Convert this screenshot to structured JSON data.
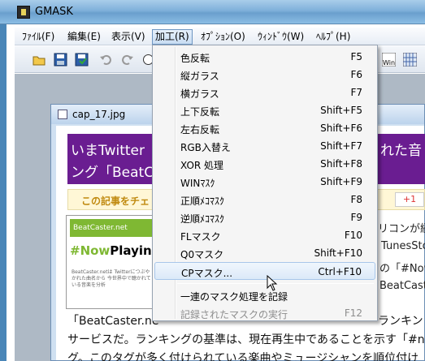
{
  "app": {
    "title": "GMASK"
  },
  "menubar": {
    "items": [
      {
        "label": "ﾌｧｲﾙ(F)"
      },
      {
        "label": "編集(E)"
      },
      {
        "label": "表示(V)"
      },
      {
        "label": "加工(R)"
      },
      {
        "label": "ｵﾌﾟｼｮﾝ(O)"
      },
      {
        "label": "ｳｨﾝﾄﾞｳ(W)"
      },
      {
        "label": "ﾍﾙﾌﾟ(H)"
      }
    ]
  },
  "toolbar": {
    "buttons": [
      "open-icon",
      "save-icon",
      "save-as-icon",
      "undo-icon",
      "redo-icon",
      "stop-icon"
    ],
    "right_label": "Win"
  },
  "child_window": {
    "title": "cap_17.jpg"
  },
  "page_content": {
    "headline_line1": "いまTwitter",
    "headline_line1_tail": "れた音",
    "headline_line2": "ング「BeatCa",
    "notice": "この記事をチェ",
    "gplus": "+1",
    "thumb_site": "BeatCaster.net",
    "thumb_tag_hash": "#Now",
    "thumb_tag_rest": "Playing!",
    "thumb_small": "BeatCaster.netは Twitterにつぶやかれた曲名から 今世界中で聴かれている音楽を分析",
    "right_lines": [
      "リコンが綴",
      "TunesSto",
      "の「#Now",
      "BeatCaste"
    ],
    "body_lines": [
      "「BeatCaster.ne",
      "サービスだ。ランキングの基準は、現在再生中であることを示す「#n",
      "グ。このタグが多く付けられている楽曲やミュージシャンを順位付け"
    ],
    "body_right": "ランキン"
  },
  "dropdown": {
    "items": [
      {
        "label": "色反転",
        "shortcut": "F5"
      },
      {
        "label": "縦ガラス",
        "shortcut": "F6"
      },
      {
        "label": "横ガラス",
        "shortcut": "F7"
      },
      {
        "label": "上下反転",
        "shortcut": "Shift+F5"
      },
      {
        "label": "左右反転",
        "shortcut": "Shift+F6"
      },
      {
        "label": "RGB入替え",
        "shortcut": "Shift+F7"
      },
      {
        "label": "XOR 処理",
        "shortcut": "Shift+F8"
      },
      {
        "label": "WINﾏｽｸ",
        "shortcut": "Shift+F9"
      },
      {
        "label": "正順ﾒｺﾏｽｸ",
        "shortcut": "F8"
      },
      {
        "label": "逆順ﾒｺﾏｽｸ",
        "shortcut": "F9"
      },
      {
        "label": "FLマスク",
        "shortcut": "F10"
      },
      {
        "label": "Q0マスク",
        "shortcut": "Shift+F10"
      },
      {
        "label": "CPマスク...",
        "shortcut": "Ctrl+F10"
      },
      {
        "label": "一連のマスク処理を記録",
        "shortcut": ""
      },
      {
        "label": "記録されたマスクの実行",
        "shortcut": "F12"
      }
    ]
  },
  "colors": {
    "header_purple": "#6a1d91",
    "notice_gold": "#c08a10",
    "thumb_green": "#7fb833"
  }
}
